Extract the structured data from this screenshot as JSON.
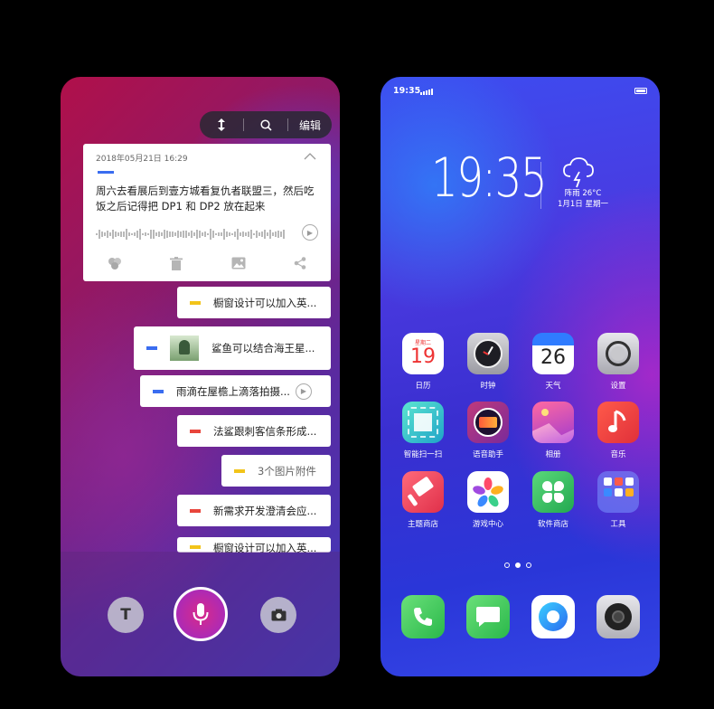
{
  "left_phone": {
    "toolbar": {
      "sort_icon": "sort-icon",
      "search_icon": "search-icon",
      "edit_label": "编辑"
    },
    "note_card": {
      "date": "2018年05月21日  16:29",
      "text": "周六去看展后到壹方城看复仇者联盟三，然后吃饭之后记得把 DP1 和 DP2 放在起来",
      "actions": [
        "palette-icon",
        "trash-icon",
        "image-icon",
        "share-icon"
      ]
    },
    "notes": [
      {
        "text": "橱窗设计可以加入英...",
        "color": "#f2c41a"
      },
      {
        "text": "鲨鱼可以结合海王星...",
        "color": "#3a6df0",
        "has_thumb": true
      },
      {
        "text": "雨滴在屋檐上滴落拍摄...",
        "color": "#3a6df0",
        "has_play": true
      },
      {
        "text": "法鲨跟刺客信条形成...",
        "color": "#e8453c"
      },
      {
        "text": "3个图片附件",
        "color": "#f2c41a"
      },
      {
        "text": "新需求开发澄清会应...",
        "color": "#e8453c"
      },
      {
        "text": "橱窗设计可以加入英...",
        "color": "#f2c41a"
      }
    ],
    "bottom": {
      "text_btn": "T"
    }
  },
  "right_phone": {
    "status_time": "19:35",
    "clock": "19:35",
    "weather": {
      "condition": "阵雨 26°C",
      "date": "1月1日 星期一"
    },
    "apps": [
      {
        "label": "日历",
        "icon": "calendar-icon",
        "weekday": "星期二",
        "day": "19"
      },
      {
        "label": "时钟",
        "icon": "clock-icon"
      },
      {
        "label": "天气",
        "icon": "weather-app-icon",
        "day": "26"
      },
      {
        "label": "设置",
        "icon": "settings-icon"
      },
      {
        "label": "智能扫一扫",
        "icon": "scan-icon"
      },
      {
        "label": "语音助手",
        "icon": "voice-assistant-icon"
      },
      {
        "label": "相册",
        "icon": "gallery-icon"
      },
      {
        "label": "音乐",
        "icon": "music-icon"
      },
      {
        "label": "主题商店",
        "icon": "theme-store-icon"
      },
      {
        "label": "游戏中心",
        "icon": "game-center-icon"
      },
      {
        "label": "软件商店",
        "icon": "app-store-icon"
      },
      {
        "label": "工具",
        "icon": "tools-folder-icon"
      }
    ],
    "page_indicator": {
      "count": 3,
      "active": 1
    },
    "dock": [
      "phone-icon",
      "messages-icon",
      "browser-icon",
      "camera-icon"
    ]
  }
}
